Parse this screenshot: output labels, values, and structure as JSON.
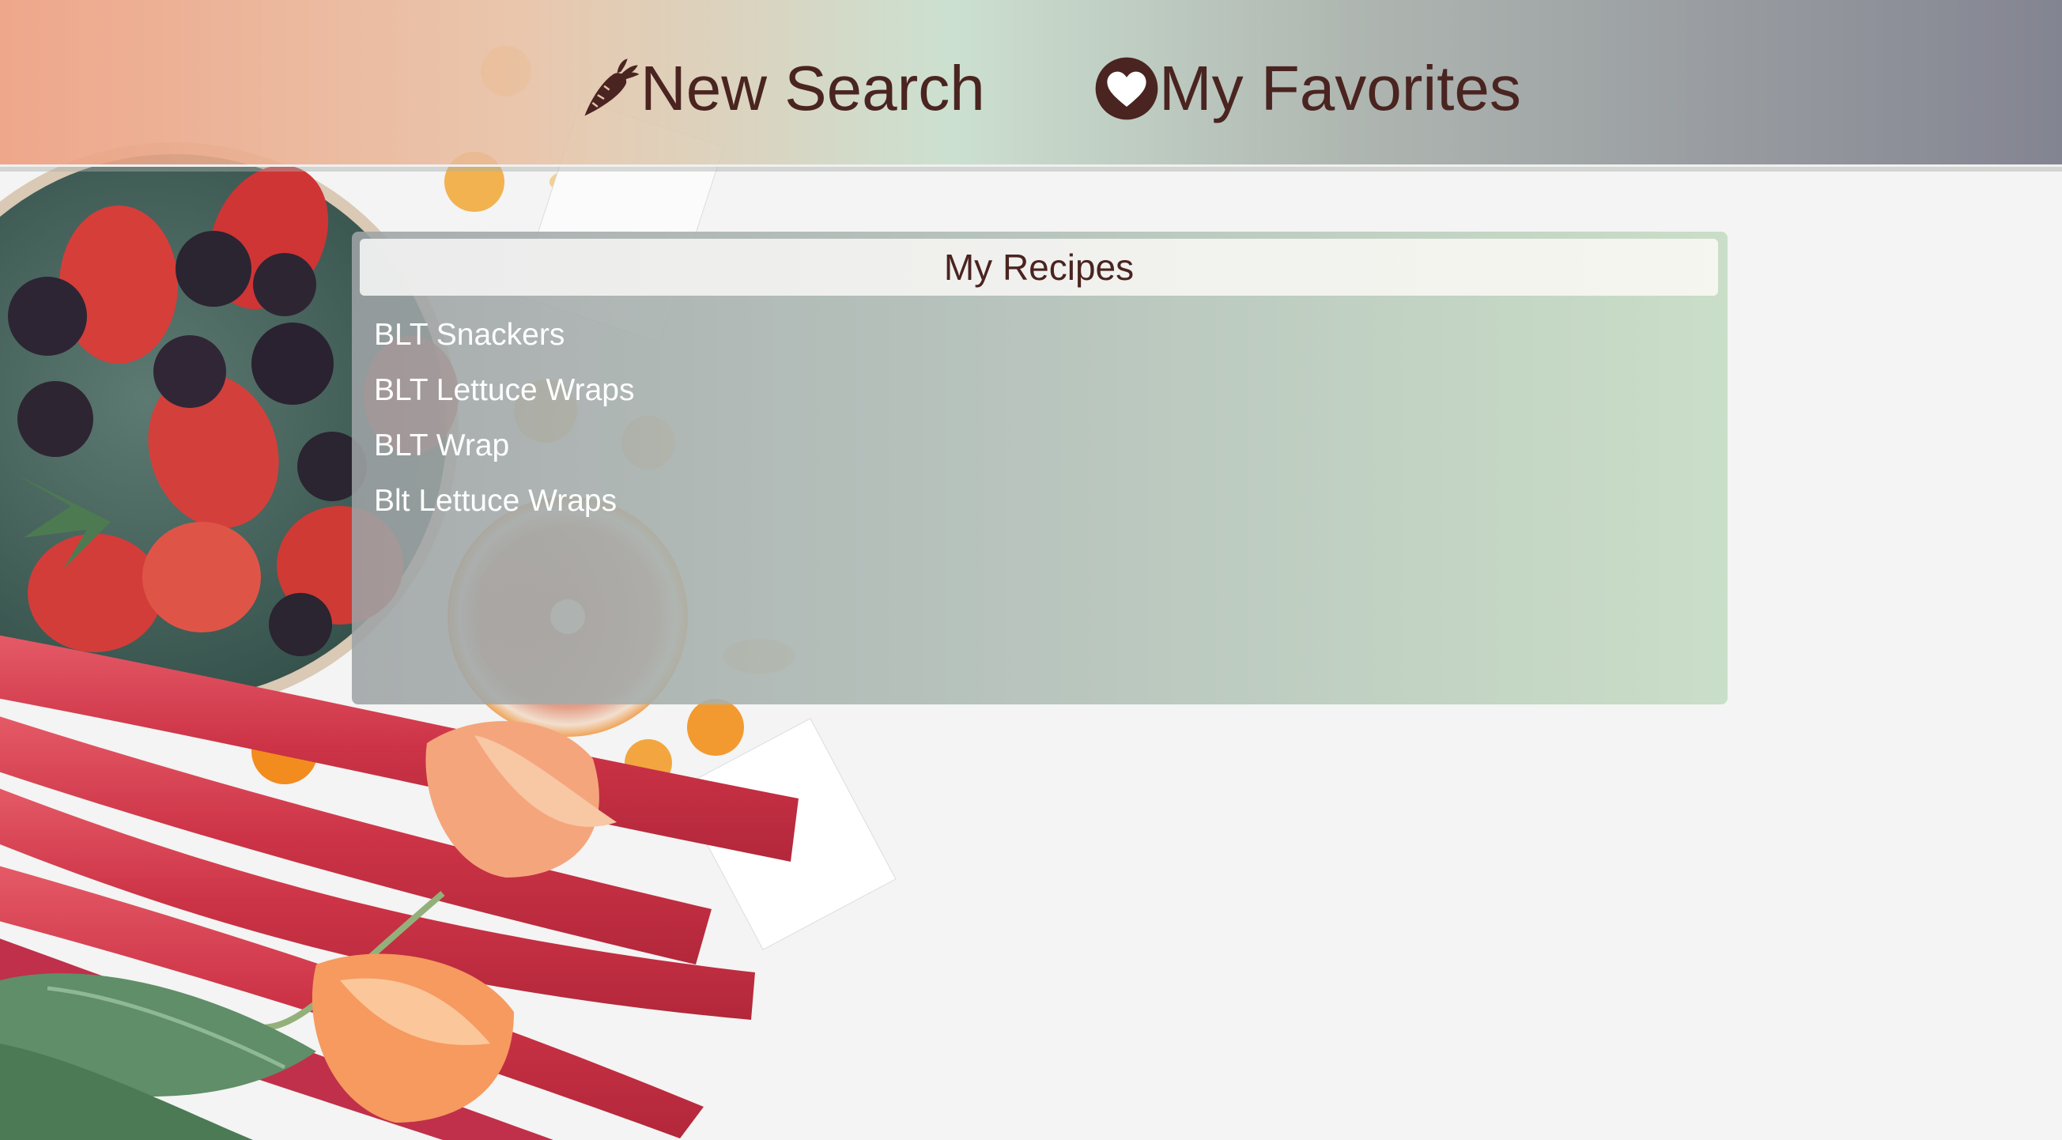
{
  "nav": {
    "new_search": {
      "label": "New Search",
      "icon": "carrot-icon"
    },
    "favorites": {
      "label": "My Favorites",
      "icon": "heart-circle-icon"
    }
  },
  "recipes": {
    "title": "My Recipes",
    "items": [
      "BLT Snackers",
      "BLT Lettuce Wraps",
      "BLT Wrap",
      "Blt Lettuce Wraps"
    ]
  },
  "colors": {
    "text_brown": "#4a2420",
    "header_left": "#eea082",
    "header_mid": "#c8decd",
    "header_right": "#7d7e8c",
    "list_text": "#ffffff"
  }
}
